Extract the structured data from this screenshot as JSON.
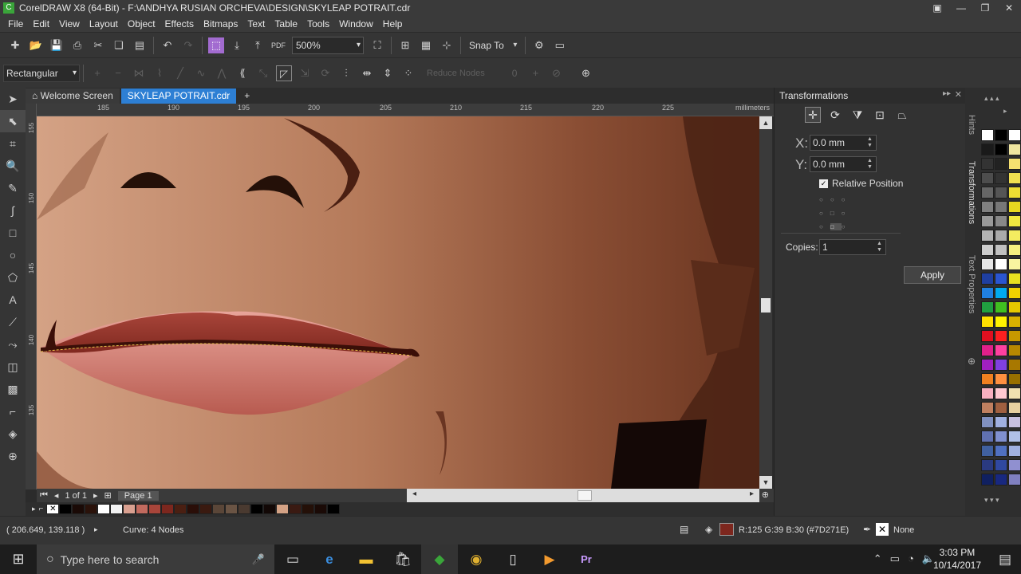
{
  "window": {
    "app_icon_label": "C",
    "title": "CorelDRAW X8 (64-Bit) - F:\\ANDHYA RUSIAN ORCHEVA\\DESIGN\\SKYLEAP POTRAIT.cdr"
  },
  "menu": [
    "File",
    "Edit",
    "View",
    "Layout",
    "Object",
    "Effects",
    "Bitmaps",
    "Text",
    "Table",
    "Tools",
    "Window",
    "Help"
  ],
  "toolbar": {
    "zoom": "500%",
    "snap_to": "Snap To"
  },
  "property_bar": {
    "mode": "Rectangular",
    "reduce_nodes": "Reduce Nodes",
    "smoothness": "0"
  },
  "tabs": {
    "welcome": "Welcome Screen",
    "document": "SKYLEAP POTRAIT.cdr"
  },
  "ruler": {
    "ticks": [
      "185",
      "190",
      "195",
      "200",
      "205",
      "210",
      "215",
      "220",
      "225"
    ],
    "units": "millimeters",
    "vticks": [
      "155",
      "150",
      "145",
      "140",
      "135"
    ]
  },
  "page_nav": {
    "count": "1 of 1",
    "page_tab": "Page 1"
  },
  "transformations": {
    "title": "Transformations",
    "x_label": "X:",
    "x_value": "0.0 mm",
    "y_label": "Y:",
    "y_value": "0.0 mm",
    "relative_position": "Relative Position",
    "copies_label": "Copies:",
    "copies_value": "1",
    "apply": "Apply"
  },
  "dockers": {
    "hints": "Hints",
    "transformations": "Transformations",
    "text_properties": "Text Properties"
  },
  "status": {
    "coords": "( 206.649, 139.118 )",
    "curve_info": "Curve: 4 Nodes",
    "fill_info": "R:125 G:39 B:30 (#7D271E)",
    "fill_color": "#7D271E",
    "outline": "None"
  },
  "taskbar": {
    "search_placeholder": "Type here to search",
    "time": "3:03 PM",
    "date": "10/14/2017"
  }
}
